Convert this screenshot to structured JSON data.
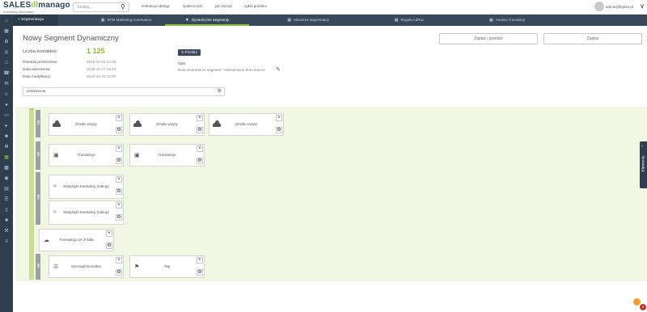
{
  "brand": {
    "name_part1": "SALES",
    "name_part2": "manago",
    "tagline": "marketing automation"
  },
  "topbar": {
    "search_placeholder": "Szukaj...",
    "links": [
      "instrukcja obsługi",
      "społeczność",
      "jak zacząć",
      "zgłoś problem"
    ],
    "user_email": "admin@firplan.pl"
  },
  "tabs": {
    "first": "Segmentacja",
    "items": [
      {
        "label": "RFM Marketing Automation"
      },
      {
        "label": "Dynamiczne Segmenty",
        "active": true
      },
      {
        "label": "Macierze segmentacji"
      },
      {
        "label": "Reguła AdRoc"
      },
      {
        "label": "Analiza Transakcji"
      }
    ]
  },
  "header": {
    "title": "Nowy Segment Dynamiczny",
    "save_recalc_label": "Zapisz i przelicz",
    "save_label": "Zapisz"
  },
  "summary": {
    "contacts_label": "Liczba kontaktów",
    "contacts_value": "1 125",
    "recalc_label": "Przelicz",
    "last_recalc_label": "Ostatnie przeliczenie",
    "last_recalc_value": "2019-10-31 12:48",
    "created_label": "Data utworzenia",
    "created_value": "2019-10-27 14:23",
    "modified_label": "Data modyfikacji",
    "modified_value": "2019-10-31 12:50",
    "description_label": "Opis",
    "description_value": "New ecommerce segment - transactions from source"
  },
  "settings": {
    "label": "Ustawienia"
  },
  "canvas": {
    "group_label": "lub",
    "rows": [
      {
        "group": true,
        "blocks": [
          {
            "label": "Źródło wizyty",
            "icon": "cloud-icon"
          },
          {
            "label": "Źródło wizyty",
            "icon": "cloud-icon"
          },
          {
            "label": "Źródło wizyty",
            "icon": "cloud-icon"
          }
        ]
      },
      {
        "group": true,
        "blocks": [
          {
            "label": "Transakcje",
            "icon": "money-icon"
          },
          {
            "label": "Transakcje",
            "icon": "money-icon"
          }
        ]
      },
      {
        "group": true,
        "blocks": [
          {
            "label": "Statystyki transakcji (zakup)",
            "icon": "signal-icon"
          },
          {
            "label": "Statystyki transakcji (zakup)",
            "icon": "signal-icon"
          }
        ]
      },
      {
        "group": false,
        "blocks": [
          {
            "label": "Transakcja ze źródła",
            "icon": "cloud-download-icon"
          }
        ]
      },
      {
        "group": true,
        "blocks": [
          {
            "label": "Szczegół kontaktu",
            "icon": "list-icon"
          },
          {
            "label": "Tag",
            "icon": "tag-icon"
          }
        ]
      }
    ]
  },
  "side_panel": {
    "label": "Elementy"
  },
  "chat": {
    "badge": "1"
  },
  "colors": {
    "accent": "#8dbd3c",
    "sidebar": "#2f3e4e",
    "canvas_bg": "#f2f7e4",
    "chat": "#f39c2f"
  }
}
